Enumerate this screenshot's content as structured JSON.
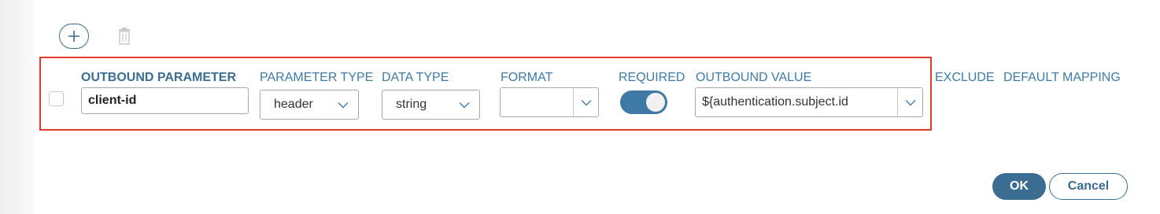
{
  "toolbar": {
    "add_icon": "plus-circle-icon",
    "delete_icon": "trash-icon"
  },
  "columns": {
    "outbound_parameter": "OUTBOUND PARAMETER",
    "parameter_type": "PARAMETER TYPE",
    "data_type": "DATA TYPE",
    "format": "FORMAT",
    "required": "REQUIRED",
    "outbound_value": "OUTBOUND VALUE",
    "exclude": "EXCLUDE",
    "default_mapping": "DEFAULT MAPPING"
  },
  "row": {
    "selected": false,
    "outbound_parameter": "client-id",
    "parameter_type": "header",
    "data_type": "string",
    "format": "",
    "required": true,
    "outbound_value": "${authentication.subject.id"
  },
  "footer": {
    "ok_label": "OK",
    "cancel_label": "Cancel"
  },
  "colors": {
    "accent": "#3b6d93",
    "highlight_border": "#e03b26",
    "toggle_on": "#3f7aa7"
  }
}
